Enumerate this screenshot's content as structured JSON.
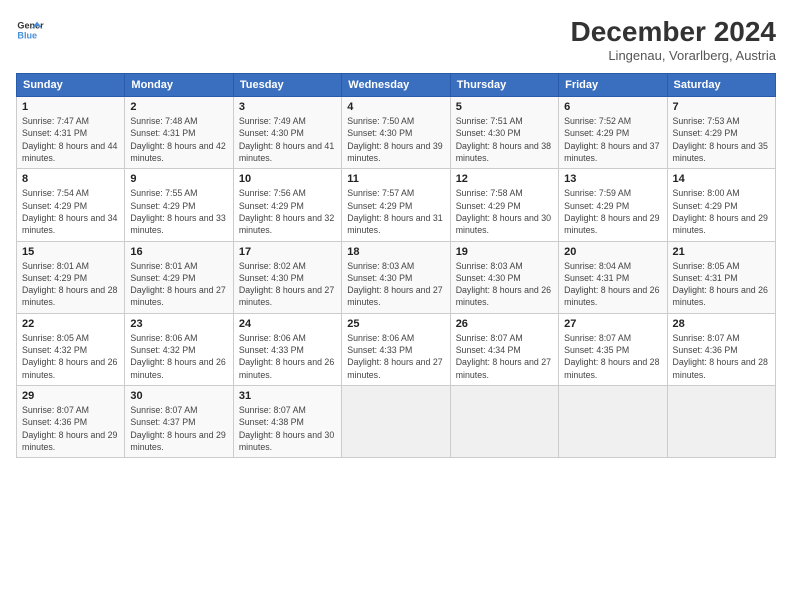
{
  "header": {
    "logo_line1": "General",
    "logo_line2": "Blue",
    "month_title": "December 2024",
    "subtitle": "Lingenau, Vorarlberg, Austria"
  },
  "days_of_week": [
    "Sunday",
    "Monday",
    "Tuesday",
    "Wednesday",
    "Thursday",
    "Friday",
    "Saturday"
  ],
  "weeks": [
    [
      {
        "day": "1",
        "sunrise": "Sunrise: 7:47 AM",
        "sunset": "Sunset: 4:31 PM",
        "daylight": "Daylight: 8 hours and 44 minutes."
      },
      {
        "day": "2",
        "sunrise": "Sunrise: 7:48 AM",
        "sunset": "Sunset: 4:31 PM",
        "daylight": "Daylight: 8 hours and 42 minutes."
      },
      {
        "day": "3",
        "sunrise": "Sunrise: 7:49 AM",
        "sunset": "Sunset: 4:30 PM",
        "daylight": "Daylight: 8 hours and 41 minutes."
      },
      {
        "day": "4",
        "sunrise": "Sunrise: 7:50 AM",
        "sunset": "Sunset: 4:30 PM",
        "daylight": "Daylight: 8 hours and 39 minutes."
      },
      {
        "day": "5",
        "sunrise": "Sunrise: 7:51 AM",
        "sunset": "Sunset: 4:30 PM",
        "daylight": "Daylight: 8 hours and 38 minutes."
      },
      {
        "day": "6",
        "sunrise": "Sunrise: 7:52 AM",
        "sunset": "Sunset: 4:29 PM",
        "daylight": "Daylight: 8 hours and 37 minutes."
      },
      {
        "day": "7",
        "sunrise": "Sunrise: 7:53 AM",
        "sunset": "Sunset: 4:29 PM",
        "daylight": "Daylight: 8 hours and 35 minutes."
      }
    ],
    [
      {
        "day": "8",
        "sunrise": "Sunrise: 7:54 AM",
        "sunset": "Sunset: 4:29 PM",
        "daylight": "Daylight: 8 hours and 34 minutes."
      },
      {
        "day": "9",
        "sunrise": "Sunrise: 7:55 AM",
        "sunset": "Sunset: 4:29 PM",
        "daylight": "Daylight: 8 hours and 33 minutes."
      },
      {
        "day": "10",
        "sunrise": "Sunrise: 7:56 AM",
        "sunset": "Sunset: 4:29 PM",
        "daylight": "Daylight: 8 hours and 32 minutes."
      },
      {
        "day": "11",
        "sunrise": "Sunrise: 7:57 AM",
        "sunset": "Sunset: 4:29 PM",
        "daylight": "Daylight: 8 hours and 31 minutes."
      },
      {
        "day": "12",
        "sunrise": "Sunrise: 7:58 AM",
        "sunset": "Sunset: 4:29 PM",
        "daylight": "Daylight: 8 hours and 30 minutes."
      },
      {
        "day": "13",
        "sunrise": "Sunrise: 7:59 AM",
        "sunset": "Sunset: 4:29 PM",
        "daylight": "Daylight: 8 hours and 29 minutes."
      },
      {
        "day": "14",
        "sunrise": "Sunrise: 8:00 AM",
        "sunset": "Sunset: 4:29 PM",
        "daylight": "Daylight: 8 hours and 29 minutes."
      }
    ],
    [
      {
        "day": "15",
        "sunrise": "Sunrise: 8:01 AM",
        "sunset": "Sunset: 4:29 PM",
        "daylight": "Daylight: 8 hours and 28 minutes."
      },
      {
        "day": "16",
        "sunrise": "Sunrise: 8:01 AM",
        "sunset": "Sunset: 4:29 PM",
        "daylight": "Daylight: 8 hours and 27 minutes."
      },
      {
        "day": "17",
        "sunrise": "Sunrise: 8:02 AM",
        "sunset": "Sunset: 4:30 PM",
        "daylight": "Daylight: 8 hours and 27 minutes."
      },
      {
        "day": "18",
        "sunrise": "Sunrise: 8:03 AM",
        "sunset": "Sunset: 4:30 PM",
        "daylight": "Daylight: 8 hours and 27 minutes."
      },
      {
        "day": "19",
        "sunrise": "Sunrise: 8:03 AM",
        "sunset": "Sunset: 4:30 PM",
        "daylight": "Daylight: 8 hours and 26 minutes."
      },
      {
        "day": "20",
        "sunrise": "Sunrise: 8:04 AM",
        "sunset": "Sunset: 4:31 PM",
        "daylight": "Daylight: 8 hours and 26 minutes."
      },
      {
        "day": "21",
        "sunrise": "Sunrise: 8:05 AM",
        "sunset": "Sunset: 4:31 PM",
        "daylight": "Daylight: 8 hours and 26 minutes."
      }
    ],
    [
      {
        "day": "22",
        "sunrise": "Sunrise: 8:05 AM",
        "sunset": "Sunset: 4:32 PM",
        "daylight": "Daylight: 8 hours and 26 minutes."
      },
      {
        "day": "23",
        "sunrise": "Sunrise: 8:06 AM",
        "sunset": "Sunset: 4:32 PM",
        "daylight": "Daylight: 8 hours and 26 minutes."
      },
      {
        "day": "24",
        "sunrise": "Sunrise: 8:06 AM",
        "sunset": "Sunset: 4:33 PM",
        "daylight": "Daylight: 8 hours and 26 minutes."
      },
      {
        "day": "25",
        "sunrise": "Sunrise: 8:06 AM",
        "sunset": "Sunset: 4:33 PM",
        "daylight": "Daylight: 8 hours and 27 minutes."
      },
      {
        "day": "26",
        "sunrise": "Sunrise: 8:07 AM",
        "sunset": "Sunset: 4:34 PM",
        "daylight": "Daylight: 8 hours and 27 minutes."
      },
      {
        "day": "27",
        "sunrise": "Sunrise: 8:07 AM",
        "sunset": "Sunset: 4:35 PM",
        "daylight": "Daylight: 8 hours and 28 minutes."
      },
      {
        "day": "28",
        "sunrise": "Sunrise: 8:07 AM",
        "sunset": "Sunset: 4:36 PM",
        "daylight": "Daylight: 8 hours and 28 minutes."
      }
    ],
    [
      {
        "day": "29",
        "sunrise": "Sunrise: 8:07 AM",
        "sunset": "Sunset: 4:36 PM",
        "daylight": "Daylight: 8 hours and 29 minutes."
      },
      {
        "day": "30",
        "sunrise": "Sunrise: 8:07 AM",
        "sunset": "Sunset: 4:37 PM",
        "daylight": "Daylight: 8 hours and 29 minutes."
      },
      {
        "day": "31",
        "sunrise": "Sunrise: 8:07 AM",
        "sunset": "Sunset: 4:38 PM",
        "daylight": "Daylight: 8 hours and 30 minutes."
      },
      null,
      null,
      null,
      null
    ]
  ]
}
